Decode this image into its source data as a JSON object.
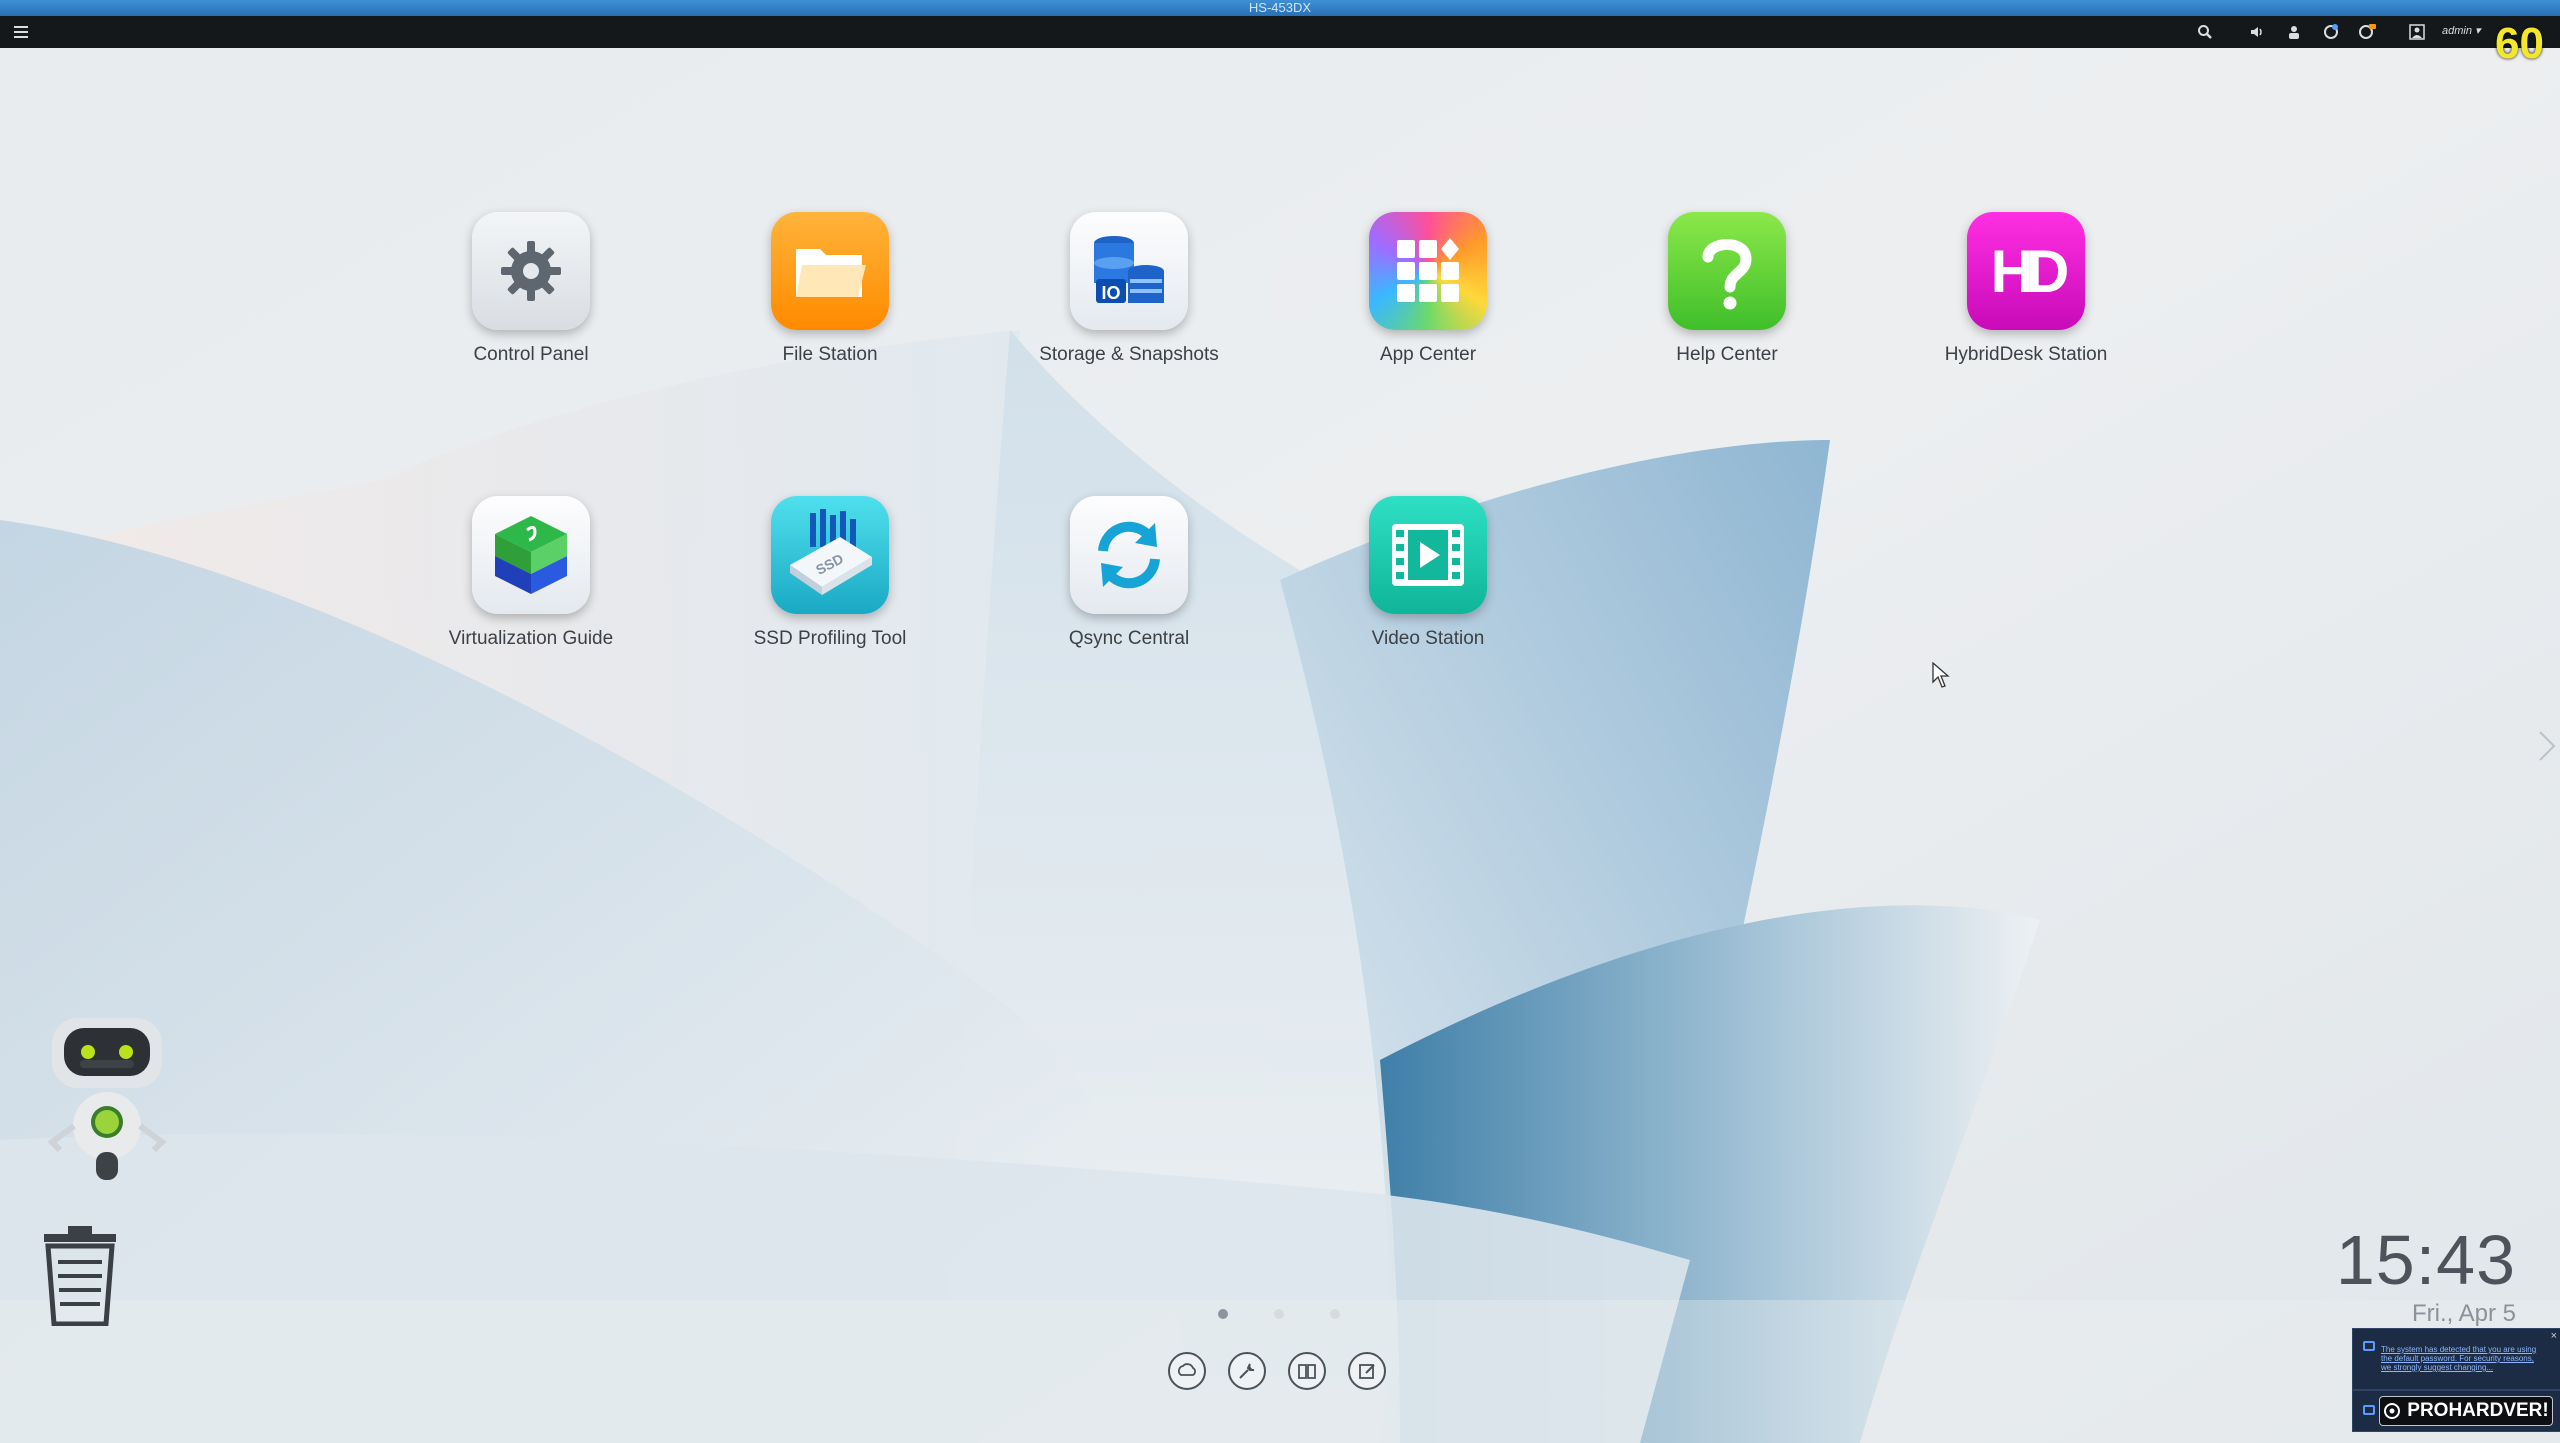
{
  "window": {
    "title": "HS-453DX"
  },
  "topbar": {
    "user_label": "admin ▾",
    "fps_overlay": "60",
    "icons": [
      "menu-icon",
      "search-icon",
      "volume-icon",
      "background-tasks-icon",
      "external-device-icon",
      "notifications-icon",
      "user-icon"
    ]
  },
  "apps": [
    {
      "label": "Control Panel",
      "icon": "gear-icon",
      "color": "#e5e8ec"
    },
    {
      "label": "File Station",
      "icon": "folder-icon",
      "color": "#ff9a16"
    },
    {
      "label": "Storage & Snapshots",
      "icon": "storage-icon",
      "color": "#f3f6fa"
    },
    {
      "label": "App Center",
      "icon": "app-grid-icon",
      "color": "#ff5fa0"
    },
    {
      "label": "Help Center",
      "icon": "question-icon",
      "color": "#5ecb2e"
    },
    {
      "label": "HybridDesk Station",
      "icon": "hd-icon",
      "color": "#e20fd0",
      "glyph": "HD"
    },
    {
      "label": "Virtualization Guide",
      "icon": "cube-icon",
      "color": "#f5f7f9"
    },
    {
      "label": "SSD Profiling Tool",
      "icon": "ssd-icon",
      "color": "#27c8d8",
      "glyph": "SSD"
    },
    {
      "label": "Qsync Central",
      "icon": "sync-icon",
      "color": "#f5f7f9"
    },
    {
      "label": "Video Station",
      "icon": "video-icon",
      "color": "#19c8ae"
    }
  ],
  "pager": {
    "pages": 3,
    "current": 1
  },
  "dock": [
    "myqnapcloud-icon",
    "utilities-icon",
    "guide-book-icon",
    "feedback-icon"
  ],
  "clock": {
    "time": "15:43",
    "date": "Fri., Apr 5"
  },
  "notification": {
    "text": "The system has detected that you are using the default password. For security reasons, we strongly suggest changing...",
    "close": "×"
  },
  "watermark": {
    "text": "PROHARDVER!"
  },
  "colors": {
    "accent": "#2a6fb4",
    "topbar": "#15181b",
    "text": "#3c4147"
  }
}
